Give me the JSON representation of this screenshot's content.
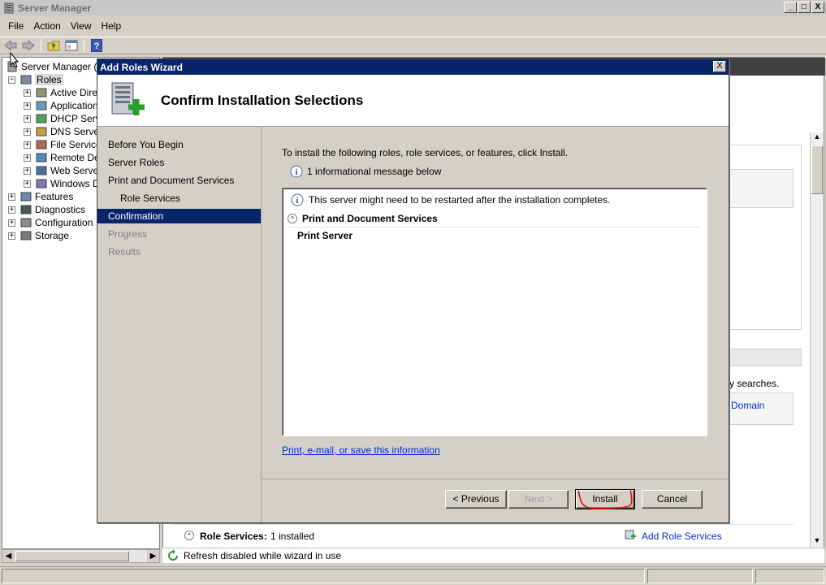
{
  "window": {
    "title": "Server Manager",
    "controls": [
      "_",
      "□",
      "X"
    ]
  },
  "menu": [
    "File",
    "Action",
    "View",
    "Help"
  ],
  "tree": {
    "root": "Server Manager (S",
    "items": [
      {
        "label": "Roles",
        "level": 1,
        "expander": "−",
        "selected": true
      },
      {
        "label": "Active Direc",
        "level": 2,
        "expander": "+"
      },
      {
        "label": "Application",
        "level": 2,
        "expander": "+"
      },
      {
        "label": "DHCP Serve",
        "level": 2,
        "expander": "+"
      },
      {
        "label": "DNS Server",
        "level": 2,
        "expander": "+"
      },
      {
        "label": "File Service",
        "level": 2,
        "expander": "+"
      },
      {
        "label": "Remote Des",
        "level": 2,
        "expander": "+"
      },
      {
        "label": "Web Server",
        "level": 2,
        "expander": "+"
      },
      {
        "label": "Windows De",
        "level": 2,
        "expander": "+"
      },
      {
        "label": "Features",
        "level": 1,
        "expander": "+"
      },
      {
        "label": "Diagnostics",
        "level": 1,
        "expander": "+"
      },
      {
        "label": "Configuration",
        "level": 1,
        "expander": "+"
      },
      {
        "label": "Storage",
        "level": 1,
        "expander": "+"
      }
    ]
  },
  "background": {
    "searches_text": "y searches.",
    "domain_link": "Domain",
    "role_services_label": "Role Services:",
    "role_services_value": "1 installed",
    "add_role_services": "Add Role Services",
    "status": "Refresh disabled while wizard in use"
  },
  "wizard": {
    "title": "Add Roles Wizard",
    "close": "X",
    "heading": "Confirm Installation Selections",
    "nav": [
      {
        "label": "Before You Begin",
        "state": "normal",
        "sub": false
      },
      {
        "label": "Server Roles",
        "state": "normal",
        "sub": false
      },
      {
        "label": "Print and Document Services",
        "state": "normal",
        "sub": false
      },
      {
        "label": "Role Services",
        "state": "normal",
        "sub": true
      },
      {
        "label": "Confirmation",
        "state": "active",
        "sub": false
      },
      {
        "label": "Progress",
        "state": "disabled",
        "sub": false
      },
      {
        "label": "Results",
        "state": "disabled",
        "sub": false
      }
    ],
    "intro": "To install the following roles, role services, or features, click Install.",
    "info_count": "1 informational message below",
    "list": {
      "message": "This server might need to be restarted after the installation completes.",
      "section": "Print and Document Services",
      "item": "Print Server",
      "collapse": "^"
    },
    "save_link": "Print, e-mail, or save this information",
    "buttons": {
      "previous": "< Previous",
      "next": "Next >",
      "install": "Install",
      "cancel": "Cancel"
    }
  }
}
